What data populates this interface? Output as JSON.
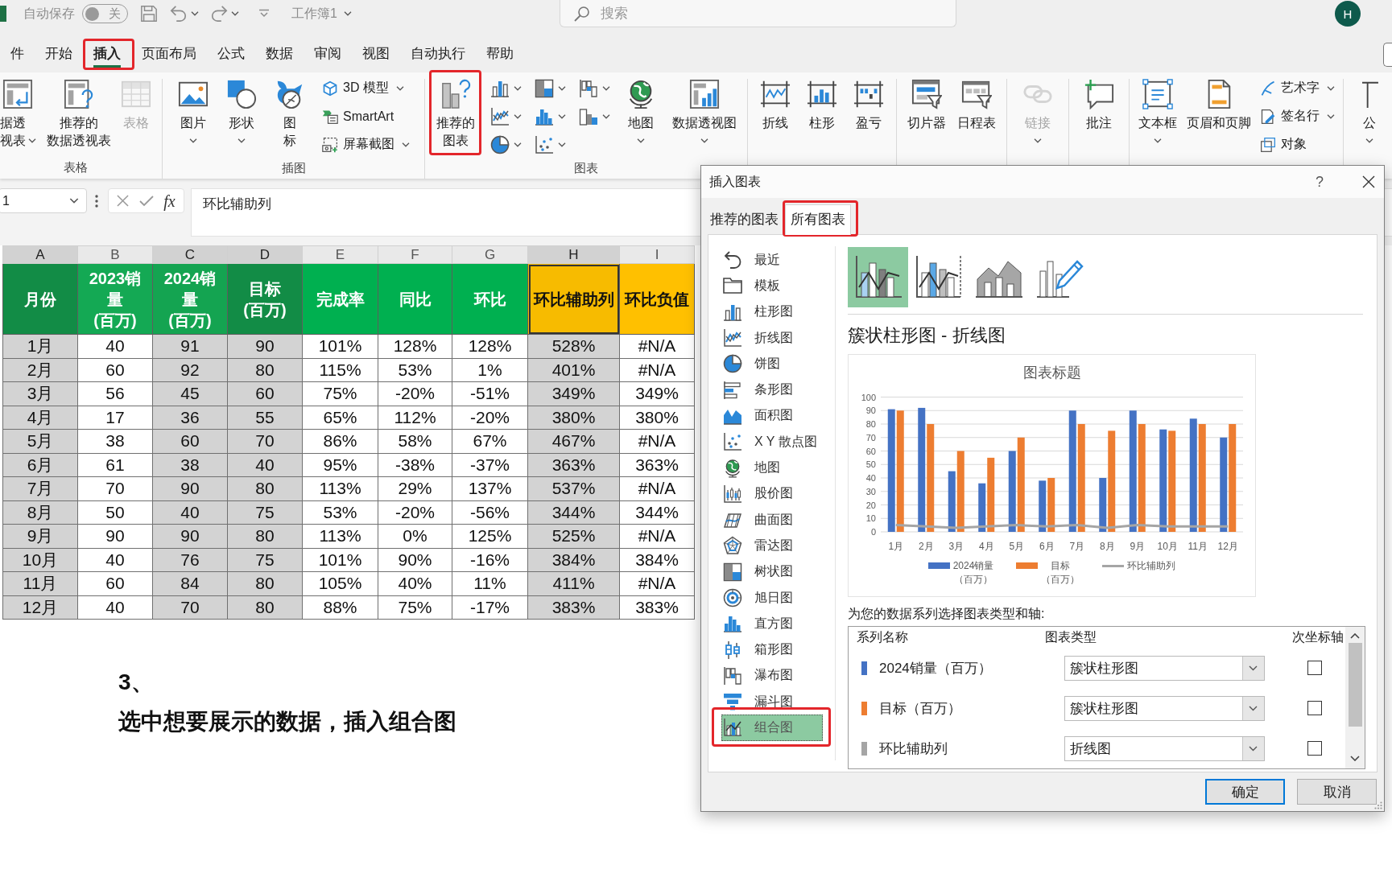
{
  "title_bar": {
    "autosave": {
      "label": "自动保存",
      "on": false,
      "state_label": "关"
    },
    "workbook": "工作簿1",
    "search": {
      "placeholder": "搜索"
    },
    "avatar": "H"
  },
  "menu_tabs": [
    {
      "label": "件",
      "selected": false,
      "annotated": false
    },
    {
      "label": "开始",
      "selected": false,
      "annotated": false
    },
    {
      "label": "插入",
      "selected": true,
      "annotated": true
    },
    {
      "label": "页面布局",
      "selected": false,
      "annotated": false
    },
    {
      "label": "公式",
      "selected": false,
      "annotated": false
    },
    {
      "label": "数据",
      "selected": false,
      "annotated": false
    },
    {
      "label": "审阅",
      "selected": false,
      "annotated": false
    },
    {
      "label": "视图",
      "selected": false,
      "annotated": false
    },
    {
      "label": "自动执行",
      "selected": false,
      "annotated": false
    },
    {
      "label": "帮助",
      "selected": false,
      "annotated": false
    }
  ],
  "ribbon": {
    "groups": [
      {
        "label": "表格",
        "buttons": [
          {
            "kind": "large",
            "label": "据透视表",
            "dropdown": true,
            "disabled": false,
            "annotated": false
          },
          {
            "kind": "large",
            "label": "推荐的数据透视表",
            "dropdown": false,
            "disabled": false,
            "annotated": false
          },
          {
            "kind": "large",
            "label": "表格",
            "dropdown": false,
            "disabled": true,
            "annotated": false
          }
        ]
      },
      {
        "label": "插图",
        "buttons": [
          {
            "kind": "large",
            "label": "图片",
            "dropdown": true,
            "disabled": false,
            "annotated": false
          },
          {
            "kind": "large",
            "label": "形状",
            "dropdown": true,
            "disabled": false,
            "annotated": false
          },
          {
            "kind": "large",
            "label": "图标",
            "dropdown": false,
            "disabled": false,
            "annotated": false
          },
          {
            "kind": "small",
            "label": "3D 模型",
            "dropdown": true,
            "disabled": false,
            "annotated": false
          },
          {
            "kind": "small",
            "label": "SmartArt",
            "dropdown": false,
            "disabled": false,
            "annotated": false
          },
          {
            "kind": "small",
            "label": "屏幕截图",
            "dropdown": true,
            "disabled": false,
            "annotated": false
          }
        ]
      },
      {
        "label": "图表",
        "buttons": [
          {
            "kind": "large",
            "label": "推荐的图表",
            "dropdown": false,
            "disabled": false,
            "annotated": true
          },
          {
            "kind": "icon",
            "dropdown": true,
            "disabled": false,
            "annotated": false
          },
          {
            "kind": "icon",
            "dropdown": true,
            "disabled": false,
            "annotated": false
          },
          {
            "kind": "icon",
            "dropdown": true,
            "disabled": false,
            "annotated": false
          },
          {
            "kind": "icon",
            "dropdown": true,
            "disabled": false,
            "annotated": false
          },
          {
            "kind": "icon",
            "dropdown": true,
            "disabled": false,
            "annotated": false
          },
          {
            "kind": "icon",
            "dropdown": true,
            "disabled": false,
            "annotated": false
          },
          {
            "kind": "icon",
            "dropdown": true,
            "disabled": false,
            "annotated": false
          },
          {
            "kind": "icon",
            "dropdown": true,
            "disabled": false,
            "annotated": false
          },
          {
            "kind": "large",
            "label": "地图",
            "dropdown": true,
            "disabled": false,
            "annotated": false
          },
          {
            "kind": "large",
            "label": "数据透视图",
            "dropdown": true,
            "disabled": false,
            "annotated": false
          }
        ]
      },
      {
        "buttons": [
          {
            "kind": "large",
            "label": "折线",
            "dropdown": false,
            "disabled": false,
            "annotated": false
          },
          {
            "kind": "large",
            "label": "柱形",
            "dropdown": false,
            "disabled": false,
            "annotated": false
          },
          {
            "kind": "large",
            "label": "盈亏",
            "dropdown": false,
            "disabled": false,
            "annotated": false
          }
        ]
      },
      {
        "buttons": [
          {
            "kind": "large",
            "label": "切片器",
            "dropdown": false,
            "disabled": false,
            "annotated": false
          },
          {
            "kind": "large",
            "label": "日程表",
            "dropdown": false,
            "disabled": false,
            "annotated": false
          }
        ]
      },
      {
        "buttons": [
          {
            "kind": "large",
            "label": "链接",
            "dropdown": true,
            "disabled": true,
            "annotated": false
          }
        ]
      },
      {
        "buttons": [
          {
            "kind": "large",
            "label": "批注",
            "dropdown": false,
            "disabled": false,
            "annotated": false
          }
        ]
      },
      {
        "buttons": [
          {
            "kind": "large",
            "label": "文本框",
            "dropdown": true,
            "disabled": false,
            "annotated": false
          },
          {
            "kind": "large",
            "label": "页眉和页脚",
            "dropdown": false,
            "disabled": false,
            "annotated": false
          },
          {
            "kind": "small",
            "label": "艺术字",
            "dropdown": true,
            "disabled": false,
            "annotated": false
          },
          {
            "kind": "small",
            "label": "签名行",
            "dropdown": true,
            "disabled": false,
            "annotated": false
          },
          {
            "kind": "small",
            "label": "对象",
            "dropdown": false,
            "disabled": false,
            "annotated": false
          }
        ]
      },
      {
        "buttons": [
          {
            "kind": "large",
            "label": "公",
            "dropdown": true,
            "disabled": false,
            "annotated": false
          }
        ]
      }
    ]
  },
  "formula_bar": {
    "name_box": "1",
    "function_label": "fx",
    "formula": "环比辅助列"
  },
  "sheet": {
    "columns": [
      {
        "letter": "A",
        "selected": true
      },
      {
        "letter": "B",
        "selected": false
      },
      {
        "letter": "C",
        "selected": true
      },
      {
        "letter": "D",
        "selected": true
      },
      {
        "letter": "E",
        "selected": false
      },
      {
        "letter": "F",
        "selected": false
      },
      {
        "letter": "G",
        "selected": false
      },
      {
        "letter": "H",
        "selected": true
      },
      {
        "letter": "I",
        "selected": false
      }
    ],
    "header": [
      {
        "text": "月份",
        "color": "#128c46",
        "active": false
      },
      {
        "text": "2023销量(百万)",
        "color": "#14a954",
        "active": false
      },
      {
        "text": "2024销量(百万)",
        "color": "#14a451",
        "active": false
      },
      {
        "text": "目标(百万)",
        "color": "#128c46",
        "active": false
      },
      {
        "text": "完成率",
        "color": "#00b050",
        "active": false
      },
      {
        "text": "同比",
        "color": "#00b050",
        "active": false
      },
      {
        "text": "环比",
        "color": "#00b050",
        "active": false
      },
      {
        "text": "环比辅助列",
        "color": "#f7bb00",
        "active": true
      },
      {
        "text": "环比负值",
        "color": "#ffc000",
        "active": false
      }
    ],
    "rows": [
      [
        "1月",
        "40",
        "91",
        "90",
        "101%",
        "128%",
        "128%",
        "528%",
        "#N/A"
      ],
      [
        "2月",
        "60",
        "92",
        "80",
        "115%",
        "53%",
        "1%",
        "401%",
        "#N/A"
      ],
      [
        "3月",
        "56",
        "45",
        "60",
        "75%",
        "-20%",
        "-51%",
        "349%",
        "349%"
      ],
      [
        "4月",
        "17",
        "36",
        "55",
        "65%",
        "112%",
        "-20%",
        "380%",
        "380%"
      ],
      [
        "5月",
        "38",
        "60",
        "70",
        "86%",
        "58%",
        "67%",
        "467%",
        "#N/A"
      ],
      [
        "6月",
        "61",
        "38",
        "40",
        "95%",
        "-38%",
        "-37%",
        "363%",
        "363%"
      ],
      [
        "7月",
        "70",
        "90",
        "80",
        "113%",
        "29%",
        "137%",
        "537%",
        "#N/A"
      ],
      [
        "8月",
        "50",
        "40",
        "75",
        "53%",
        "-20%",
        "-56%",
        "344%",
        "344%"
      ],
      [
        "9月",
        "90",
        "90",
        "80",
        "113%",
        "0%",
        "125%",
        "525%",
        "#N/A"
      ],
      [
        "10月",
        "40",
        "76",
        "75",
        "101%",
        "90%",
        "-16%",
        "384%",
        "384%"
      ],
      [
        "11月",
        "60",
        "84",
        "80",
        "105%",
        "40%",
        "11%",
        "411%",
        "#N/A"
      ],
      [
        "12月",
        "40",
        "70",
        "80",
        "88%",
        "75%",
        "-17%",
        "383%",
        "383%"
      ]
    ]
  },
  "note": {
    "step": "3、",
    "text": "选中想要展示的数据，插入组合图"
  },
  "dialog": {
    "title": "插入图表",
    "help": "?",
    "tabs": [
      {
        "label": "推荐的图表",
        "selected": false,
        "annotated": false
      },
      {
        "label": "所有图表",
        "selected": true,
        "annotated": true
      }
    ],
    "chart_types": [
      {
        "label": "最近",
        "selected": false,
        "annotated": false
      },
      {
        "label": "模板",
        "selected": false,
        "annotated": false
      },
      {
        "label": "柱形图",
        "selected": false,
        "annotated": false
      },
      {
        "label": "折线图",
        "selected": false,
        "annotated": false
      },
      {
        "label": "饼图",
        "selected": false,
        "annotated": false
      },
      {
        "label": "条形图",
        "selected": false,
        "annotated": false
      },
      {
        "label": "面积图",
        "selected": false,
        "annotated": false
      },
      {
        "label": "X Y 散点图",
        "selected": false,
        "annotated": false
      },
      {
        "label": "地图",
        "selected": false,
        "annotated": false
      },
      {
        "label": "股价图",
        "selected": false,
        "annotated": false
      },
      {
        "label": "曲面图",
        "selected": false,
        "annotated": false
      },
      {
        "label": "雷达图",
        "selected": false,
        "annotated": false
      },
      {
        "label": "树状图",
        "selected": false,
        "annotated": false
      },
      {
        "label": "旭日图",
        "selected": false,
        "annotated": false
      },
      {
        "label": "直方图",
        "selected": false,
        "annotated": false
      },
      {
        "label": "箱形图",
        "selected": false,
        "annotated": false
      },
      {
        "label": "瀑布图",
        "selected": false,
        "annotated": false
      },
      {
        "label": "漏斗图",
        "selected": false,
        "annotated": false
      },
      {
        "label": "组合图",
        "selected": true,
        "annotated": true
      }
    ],
    "subtypes": [
      {
        "selected": true
      },
      {
        "selected": false
      },
      {
        "selected": false
      },
      {
        "selected": false
      }
    ],
    "subtype_title": "簇状柱形图 - 折线图",
    "chart_preview": {
      "chart_data": {
        "type": "bar",
        "title": "图表标题",
        "categories": [
          "1月",
          "2月",
          "3月",
          "4月",
          "5月",
          "6月",
          "7月",
          "8月",
          "9月",
          "10月",
          "11月",
          "12月"
        ],
        "series": [
          {
            "name": "2024销量（百万）",
            "type": "bar",
            "color": "#4472c4",
            "values": [
              91,
              92,
              45,
              36,
              60,
              38,
              90,
              40,
              90,
              76,
              84,
              70
            ]
          },
          {
            "name": "目标（百万）",
            "type": "bar",
            "color": "#ed7d31",
            "values": [
              90,
              80,
              60,
              55,
              70,
              40,
              80,
              75,
              80,
              75,
              80,
              80
            ]
          },
          {
            "name": "环比辅助列",
            "type": "line",
            "color": "#a5a5a5",
            "values": [
              5,
              4,
              3,
              4,
              5,
              4,
              5,
              3,
              5,
              4,
              4,
              4
            ]
          }
        ],
        "ylim": [
          0,
          100
        ],
        "yticks": [
          0,
          10,
          20,
          30,
          40,
          50,
          60,
          70,
          80,
          90,
          100
        ],
        "grid": true,
        "legend": "bottom"
      }
    },
    "series_prompt": "为您的数据系列选择图表类型和轴:",
    "series_table": {
      "columns": [
        "系列名称",
        "图表类型",
        "次坐标轴"
      ],
      "rows": [
        {
          "name": "2024销量（百万）",
          "color": "#4472c4",
          "chart_type": "簇状柱形图",
          "checked": false
        },
        {
          "name": "目标（百万）",
          "color": "#ed7d31",
          "chart_type": "簇状柱形图",
          "checked": false
        },
        {
          "name": "环比辅助列",
          "color": "#a5a5a5",
          "chart_type": "折线图",
          "checked": false
        }
      ]
    },
    "buttons": [
      {
        "label": "确定",
        "default": true
      },
      {
        "label": "取消",
        "default": false
      }
    ]
  }
}
